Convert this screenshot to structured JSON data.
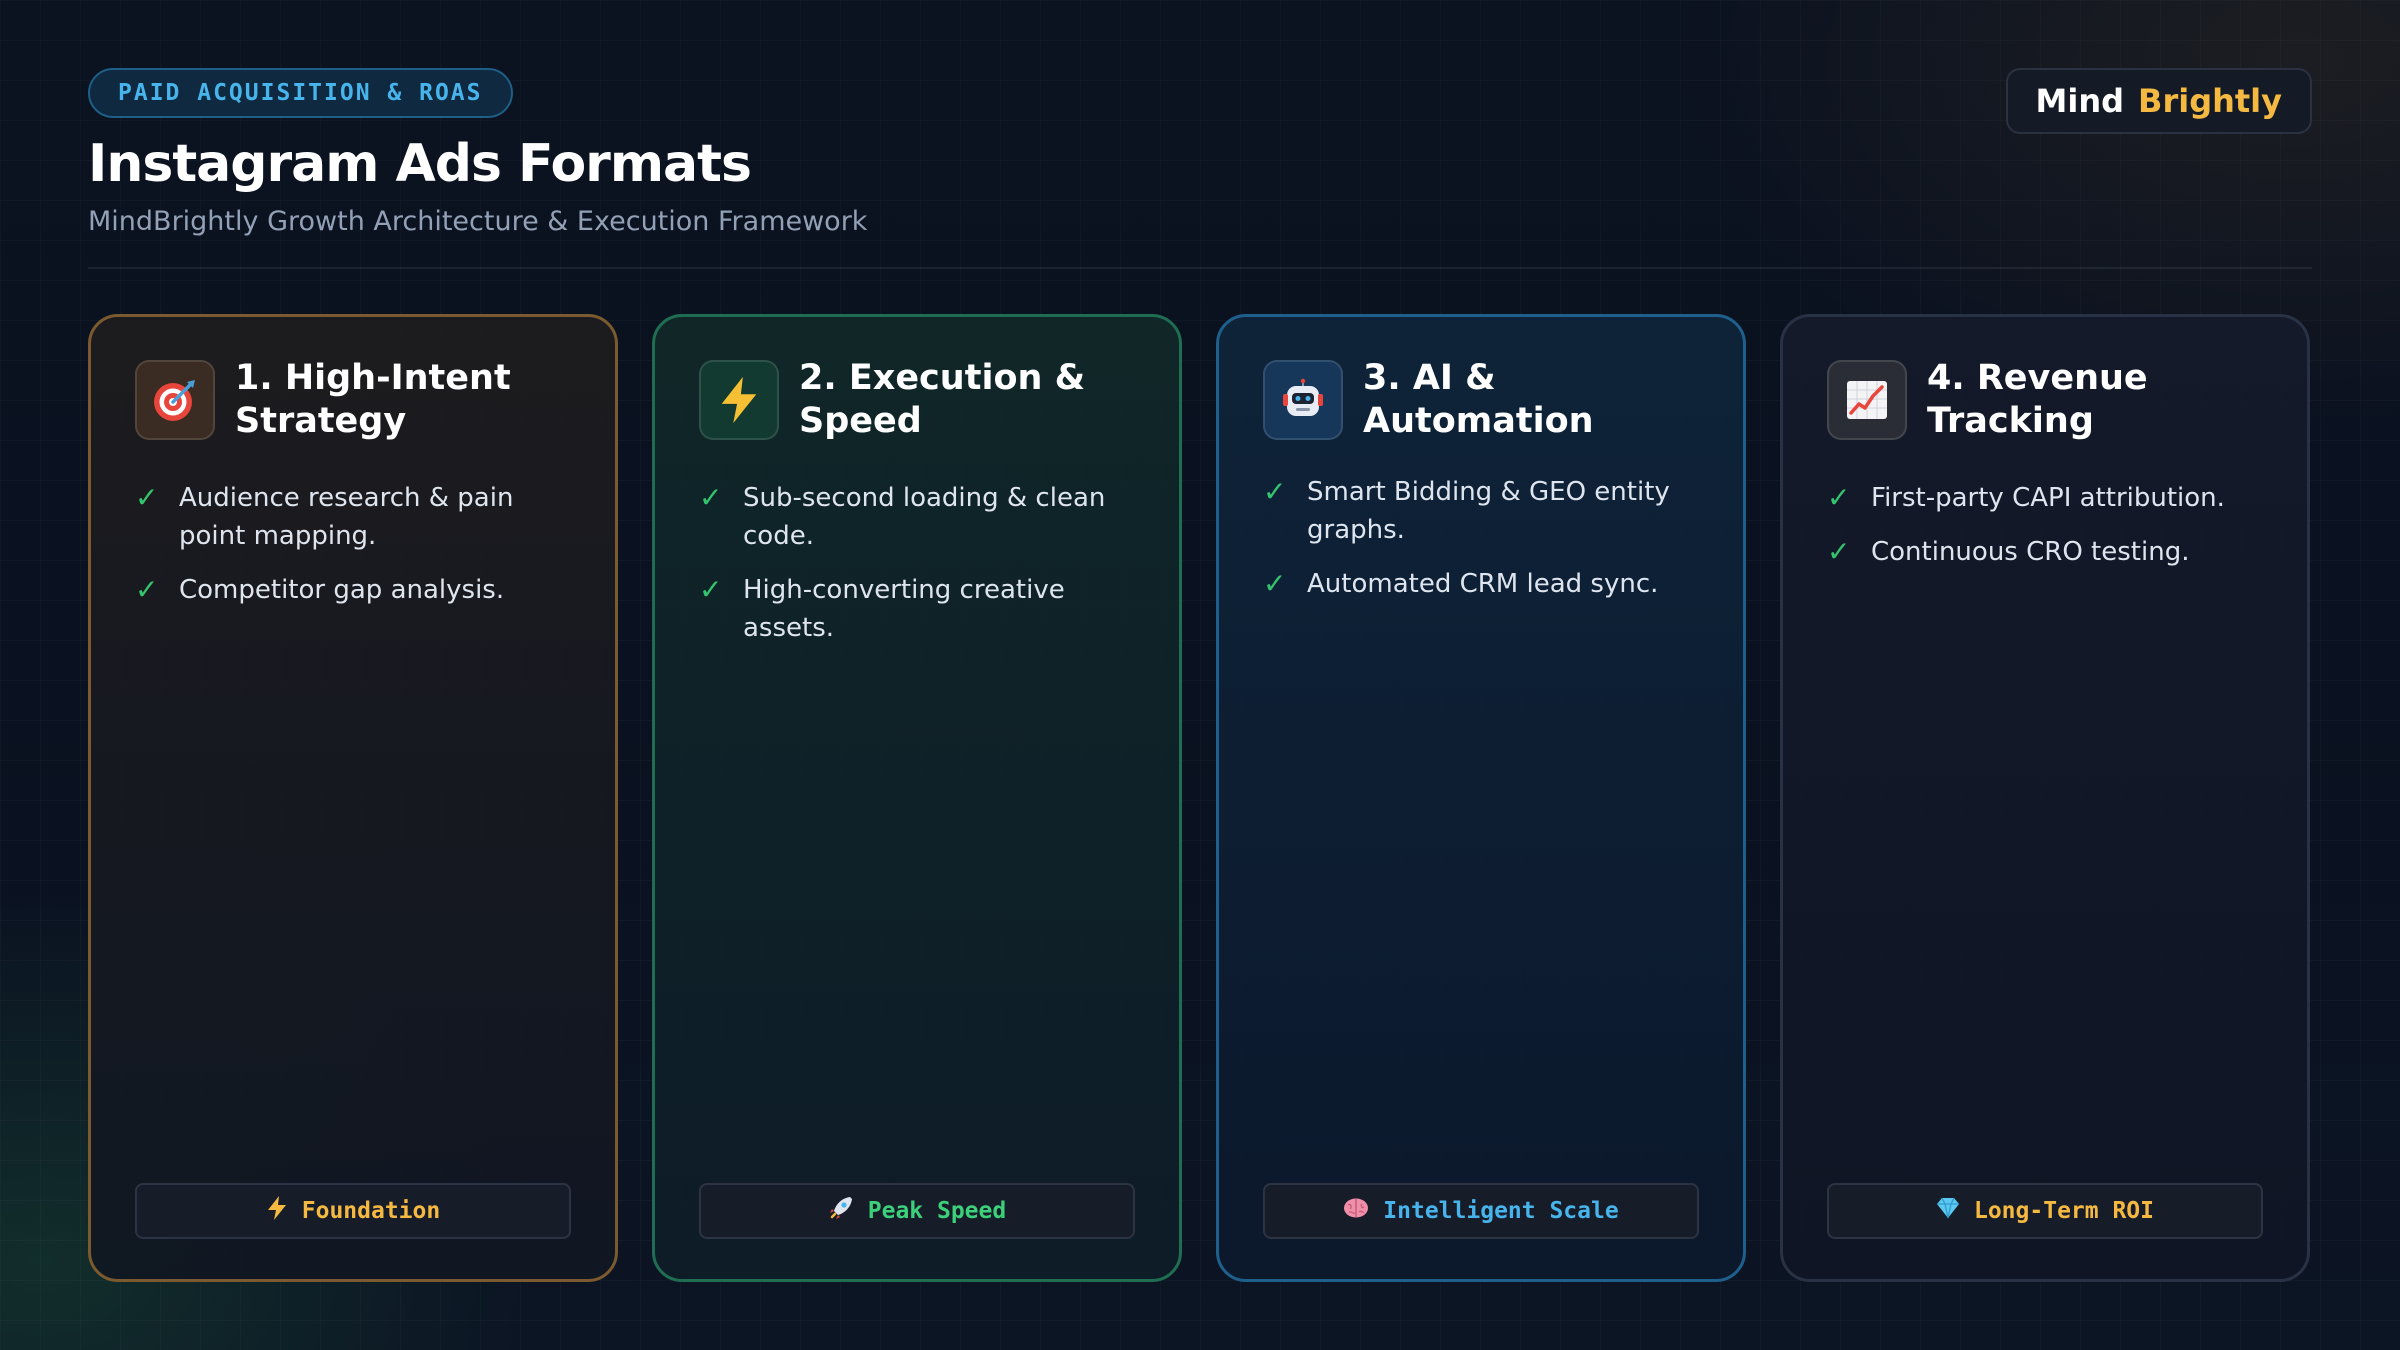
{
  "header": {
    "tag": "PAID ACQUISITION & ROAS",
    "title": "Instagram Ads Formats",
    "subtitle": "MindBrightly Growth Architecture & Execution Framework"
  },
  "brand": {
    "word1": "Mind",
    "word2": "Brightly"
  },
  "colors": {
    "accent_gold": "#f5b942",
    "accent_green": "#3cd07a",
    "accent_blue": "#48b4ec",
    "check_green": "#35c46e"
  },
  "cards": [
    {
      "title": "1. High-Intent Strategy",
      "icon": "target-icon",
      "items": [
        "Audience research & pain point mapping.",
        "Competitor gap analysis."
      ],
      "badge": {
        "icon": "lightning-icon",
        "label": "Foundation"
      }
    },
    {
      "title": "2. Execution & Speed",
      "icon": "lightning-icon",
      "items": [
        "Sub-second loading & clean code.",
        "High-converting creative assets."
      ],
      "badge": {
        "icon": "rocket-icon",
        "label": "Peak Speed"
      }
    },
    {
      "title": "3. AI & Automation",
      "icon": "robot-icon",
      "items": [
        "Smart Bidding & GEO entity graphs.",
        "Automated CRM lead sync."
      ],
      "badge": {
        "icon": "brain-icon",
        "label": "Intelligent Scale"
      }
    },
    {
      "title": "4. Revenue Tracking",
      "icon": "chart-increasing-icon",
      "items": [
        "First-party CAPI attribution.",
        "Continuous CRO testing."
      ],
      "badge": {
        "icon": "gem-icon",
        "label": "Long-Term ROI"
      }
    }
  ]
}
